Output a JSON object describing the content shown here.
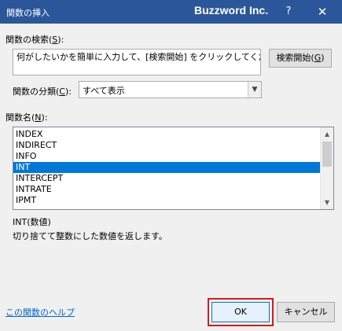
{
  "window": {
    "title": "関数の挿入",
    "brand": "Buzzword Inc.",
    "help_glyph": "?",
    "close_glyph": "✕"
  },
  "search": {
    "label_prefix": "関数の検索(",
    "label_key": "S",
    "label_suffix": "):",
    "input_value": "何がしたいかを簡単に入力して、[検索開始] をクリックしてください。",
    "button_prefix": "検索開始(",
    "button_key": "G",
    "button_suffix": ")"
  },
  "category": {
    "label_prefix": "関数の分類(",
    "label_key": "C",
    "label_suffix": "):",
    "selected": "すべて表示"
  },
  "functions": {
    "label_prefix": "関数名(",
    "label_key": "N",
    "label_suffix": "):",
    "items": [
      "INDEX",
      "INDIRECT",
      "INFO",
      "INT",
      "INTERCEPT",
      "INTRATE",
      "IPMT"
    ],
    "selected": "INT"
  },
  "description": {
    "signature": "INT(数値)",
    "text": "切り捨てて整数にした数値を返します。"
  },
  "footer": {
    "help_link": "この関数のヘルプ",
    "ok_label": "OK",
    "cancel_label": "キャンセル"
  }
}
